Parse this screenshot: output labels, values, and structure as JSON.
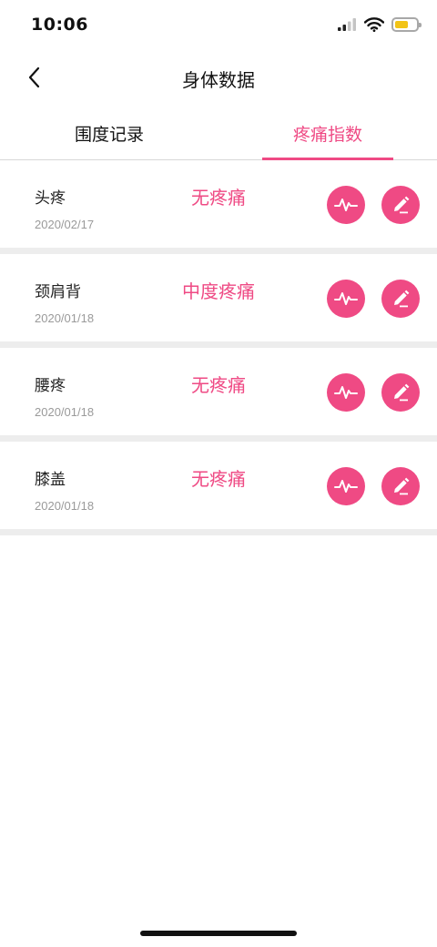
{
  "status_bar": {
    "time": "10:06"
  },
  "header": {
    "title": "身体数据"
  },
  "tabs": [
    {
      "label": "围度记录",
      "active": false
    },
    {
      "label": "疼痛指数",
      "active": true
    }
  ],
  "records": [
    {
      "name": "头疼",
      "date": "2020/02/17",
      "level": "无疼痛"
    },
    {
      "name": "颈肩背",
      "date": "2020/01/18",
      "level": "中度疼痛"
    },
    {
      "name": "腰疼",
      "date": "2020/01/18",
      "level": "无疼痛"
    },
    {
      "name": "膝盖",
      "date": "2020/01/18",
      "level": "无疼痛"
    }
  ],
  "colors": {
    "accent": "#ef4a84",
    "battery": "#f2c417",
    "divider": "#ededed"
  },
  "icons": {
    "chart": "heartbeat-icon",
    "edit": "pencil-icon",
    "back": "chevron-left-icon"
  }
}
